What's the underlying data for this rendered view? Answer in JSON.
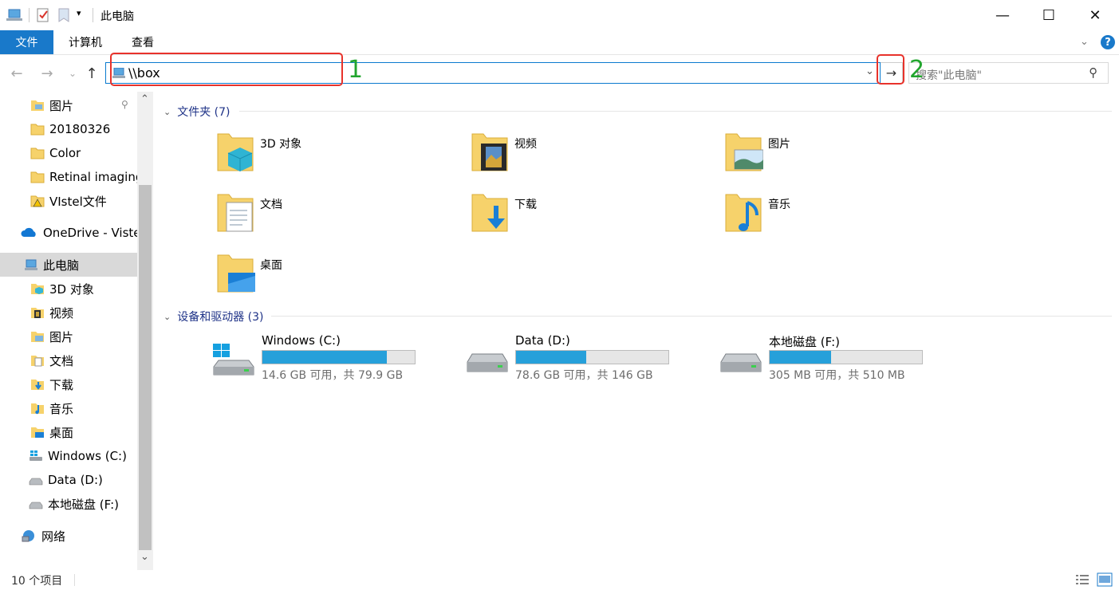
{
  "window": {
    "title": "此电脑",
    "minimize_glyph": "—",
    "maximize_glyph": "☐",
    "close_glyph": "✕"
  },
  "ribbon": {
    "tabs": [
      {
        "label": "文件",
        "active": true
      },
      {
        "label": "计算机",
        "active": false
      },
      {
        "label": "查看",
        "active": false
      }
    ]
  },
  "nav": {
    "back_glyph": "←",
    "forward_glyph": "→",
    "recent_glyph": "⌄",
    "up_glyph": "↑",
    "address_value": "\\\\box",
    "dropdown_glyph": "⌄",
    "go_glyph": "→",
    "search_placeholder": "搜索\"此电脑\"",
    "search_glyph": "⚲"
  },
  "annotations": {
    "label1": "1",
    "label2": "2",
    "color_box": "#e8322b",
    "color_num": "#22a52e"
  },
  "sidebar": {
    "items": [
      {
        "label": "图片",
        "icon": "pictures-folder-icon",
        "pinned": true
      },
      {
        "label": "20180326",
        "icon": "folder-icon"
      },
      {
        "label": "Color",
        "icon": "folder-icon"
      },
      {
        "label": "Retinal imaging",
        "icon": "folder-icon"
      },
      {
        "label": "VIstel文件",
        "icon": "warning-folder-icon"
      },
      {
        "label": "OneDrive - Visteon",
        "icon": "onedrive-icon"
      },
      {
        "label": "此电脑",
        "icon": "this-pc-icon",
        "selected": true
      },
      {
        "label": "3D 对象",
        "icon": "3d-objects-icon"
      },
      {
        "label": "视频",
        "icon": "videos-icon"
      },
      {
        "label": "图片",
        "icon": "pictures-icon"
      },
      {
        "label": "文档",
        "icon": "documents-icon"
      },
      {
        "label": "下载",
        "icon": "downloads-icon"
      },
      {
        "label": "音乐",
        "icon": "music-icon"
      },
      {
        "label": "桌面",
        "icon": "desktop-icon"
      },
      {
        "label": "Windows (C:)",
        "icon": "windows-drive-icon"
      },
      {
        "label": "Data (D:)",
        "icon": "drive-icon"
      },
      {
        "label": "本地磁盘 (F:)",
        "icon": "drive-icon"
      },
      {
        "label": "网络",
        "icon": "network-icon"
      }
    ],
    "pin_glyph": "📌",
    "scroll_up": "⌃",
    "scroll_down": "⌄"
  },
  "main": {
    "folders_header": "文件夹 (7)",
    "folders": [
      {
        "label": "3D 对象",
        "icon": "3d-objects-folder-icon"
      },
      {
        "label": "视频",
        "icon": "videos-folder-icon"
      },
      {
        "label": "图片",
        "icon": "pictures-folder-icon"
      },
      {
        "label": "文档",
        "icon": "documents-folder-icon"
      },
      {
        "label": "下载",
        "icon": "downloads-folder-icon"
      },
      {
        "label": "音乐",
        "icon": "music-folder-icon"
      },
      {
        "label": "桌面",
        "icon": "desktop-folder-icon"
      }
    ],
    "drives_header": "设备和驱动器 (3)",
    "drives": [
      {
        "name": "Windows (C:)",
        "free_text": "14.6 GB 可用，共 79.9 GB",
        "used_fraction": 0.817
      },
      {
        "name": "Data (D:)",
        "free_text": "78.6 GB 可用，共 146 GB",
        "used_fraction": 0.462
      },
      {
        "name": "本地磁盘 (F:)",
        "free_text": "305 MB 可用，共 510 MB",
        "used_fraction": 0.402
      }
    ],
    "accent_color": "#26a0da"
  },
  "status": {
    "item_count": "10 个项目"
  }
}
